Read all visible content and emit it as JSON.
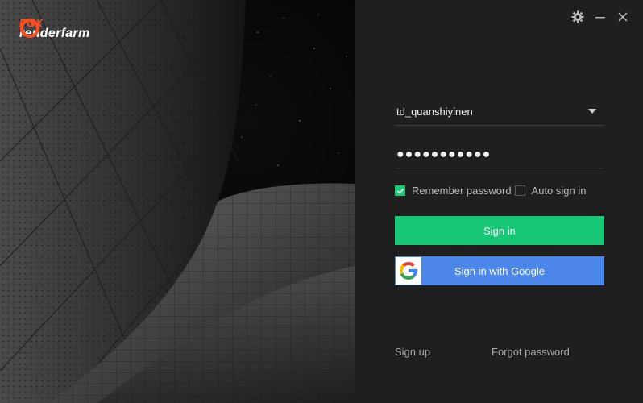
{
  "brand": {
    "name_top": "FOX",
    "name_bottom": "renderfarm",
    "accent": "#ff4d1f"
  },
  "window": {
    "settings_icon": "gear-icon",
    "minimize_icon": "minimize-icon",
    "close_icon": "close-icon"
  },
  "login": {
    "username": "td_quanshiyinen",
    "password_mask": "●●●●●●●●●●●",
    "remember_label": "Remember password",
    "remember_checked": true,
    "auto_label": "Auto sign in",
    "auto_checked": false,
    "signin_label": "Sign in",
    "google_label": "Sign in with Google",
    "signup_label": "Sign up",
    "forgot_label": "Forgot password"
  },
  "colors": {
    "signin_button": "#17c776",
    "google_button": "#4b86e8",
    "panel_bg": "#1f1f1f"
  }
}
